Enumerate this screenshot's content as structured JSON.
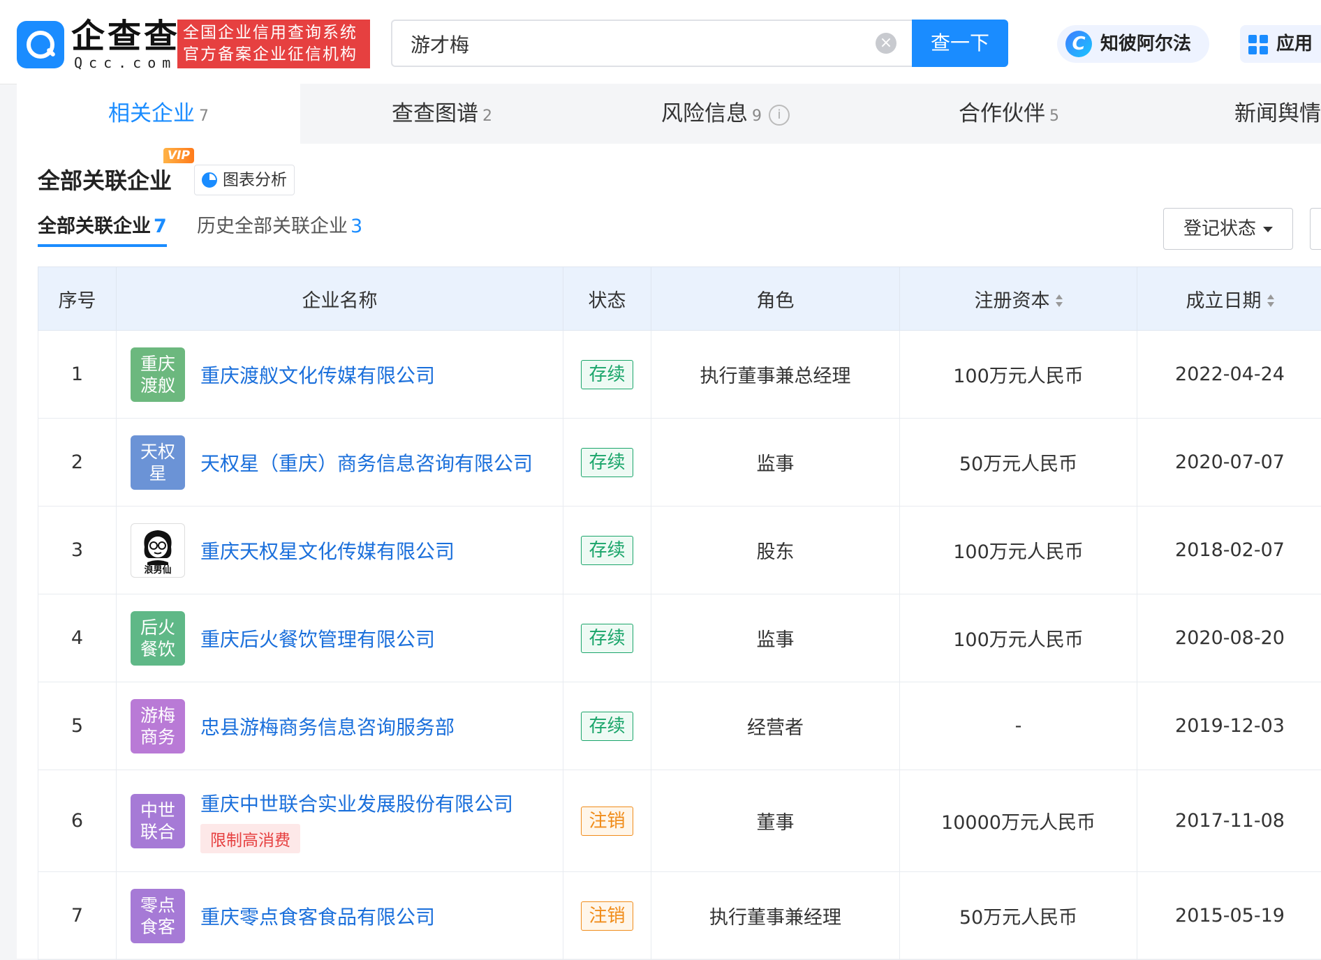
{
  "header": {
    "logo_text": "企查查",
    "logo_sub": "Qcc.com",
    "slogan_line1": "全国企业信用查询系统",
    "slogan_line2": "官方备案企业征信机构",
    "search_value": "游才梅",
    "search_button": "查一下",
    "ai_label": "知彼阿尔法",
    "app_label": "应用"
  },
  "tabs": [
    {
      "label": "相关企业",
      "count": "7"
    },
    {
      "label": "查查图谱",
      "count": "2"
    },
    {
      "label": "风险信息",
      "count": "9"
    },
    {
      "label": "合作伙伴",
      "count": "5"
    },
    {
      "label": "新闻舆情",
      "count": ""
    }
  ],
  "section": {
    "title": "全部关联企业",
    "vip": "VIP",
    "chart_button": "图表分析",
    "subtabs": [
      {
        "label": "全部关联企业",
        "count": "7"
      },
      {
        "label": "历史全部关联企业",
        "count": "3"
      }
    ],
    "filter": "登记状态"
  },
  "table": {
    "headers": [
      "序号",
      "企业名称",
      "状态",
      "角色",
      "注册资本",
      "成立日期"
    ],
    "rows": [
      {
        "no": "1",
        "avatar": "重庆渡舣",
        "avatar_color": "#6cb87e",
        "name": "重庆渡舣文化传媒有限公司",
        "tag": "",
        "status": "存续",
        "role": "执行董事兼总经理",
        "capital": "100万元人民币",
        "date": "2022-04-24"
      },
      {
        "no": "2",
        "avatar": "天权星",
        "avatar_color": "#6b93d6",
        "name": "天权星（重庆）商务信息咨询有限公司",
        "tag": "",
        "status": "存续",
        "role": "监事",
        "capital": "50万元人民币",
        "date": "2020-07-07"
      },
      {
        "no": "3",
        "avatar": "浪男仙",
        "avatar_color": "",
        "name": "重庆天权星文化传媒有限公司",
        "tag": "",
        "status": "存续",
        "role": "股东",
        "capital": "100万元人民币",
        "date": "2018-02-07"
      },
      {
        "no": "4",
        "avatar": "后火餐饮",
        "avatar_color": "#5fb887",
        "name": "重庆后火餐饮管理有限公司",
        "tag": "",
        "status": "存续",
        "role": "监事",
        "capital": "100万元人民币",
        "date": "2020-08-20"
      },
      {
        "no": "5",
        "avatar": "游梅商务",
        "avatar_color": "#b97ad6",
        "name": "忠县游梅商务信息咨询服务部",
        "tag": "",
        "status": "存续",
        "role": "经营者",
        "capital": "-",
        "date": "2019-12-03"
      },
      {
        "no": "6",
        "avatar": "中世联合",
        "avatar_color": "#a67ad6",
        "name": "重庆中世联合实业发展股份有限公司",
        "tag": "限制高消费",
        "status": "注销",
        "role": "董事",
        "capital": "10000万元人民币",
        "date": "2017-11-08"
      },
      {
        "no": "7",
        "avatar": "零点食客",
        "avatar_color": "#a67ad6",
        "name": "重庆零点食客食品有限公司",
        "tag": "",
        "status": "注销",
        "role": "执行董事兼经理",
        "capital": "50万元人民币",
        "date": "2015-05-19"
      }
    ]
  }
}
